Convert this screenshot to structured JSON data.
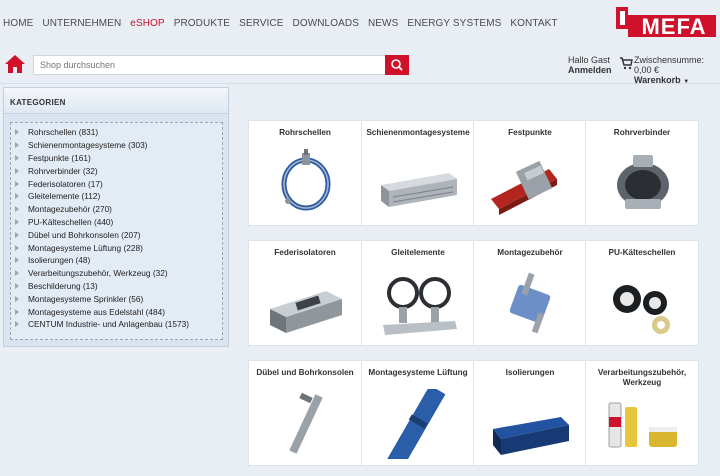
{
  "nav": {
    "items": [
      "HOME",
      "UNTERNEHMEN",
      "eSHOP",
      "PRODUKTE",
      "SERVICE",
      "DOWNLOADS",
      "NEWS",
      "ENERGY SYSTEMS",
      "KONTAKT"
    ],
    "active": "eSHOP"
  },
  "logo": {
    "text": "MEFA",
    "color": "#d0112b"
  },
  "search": {
    "placeholder": "Shop durchsuchen"
  },
  "account": {
    "greeting": "Hallo Gast",
    "login": "Anmelden"
  },
  "cart": {
    "subtotal": "Zwischensumme: 0,00 €",
    "label": "Warenkorb"
  },
  "sidebar": {
    "title": "KATEGORIEN",
    "items": [
      "Rohrschellen (831)",
      "Schienenmontagesysteme (303)",
      "Festpunkte (161)",
      "Rohrverbinder (32)",
      "Federisolatoren (17)",
      "Gleitelemente (112)",
      "Montagezubehör (270)",
      "PU-Kälteschellen (440)",
      "Dübel und Bohrkonsolen (207)",
      "Montagesysteme Lüftung (228)",
      "Isolierungen (48)",
      "Verarbeitungszubehör, Werkzeug (32)",
      "Beschilderung (13)",
      "Montagesysteme Sprinkler (56)",
      "Montagesysteme aus Edelstahl (484)",
      "CENTUM Industrie- und Anlagenbau (1573)"
    ]
  },
  "tiles": [
    {
      "title": "Rohrschellen",
      "icon": "pipe-clamp-icon"
    },
    {
      "title": "Schienenmontagesysteme",
      "icon": "rail-icon"
    },
    {
      "title": "Festpunkte",
      "icon": "fixed-point-icon"
    },
    {
      "title": "Rohrverbinder",
      "icon": "pipe-connector-icon"
    },
    {
      "title": "Federisolatoren",
      "icon": "spring-isolator-icon"
    },
    {
      "title": "Gleitelemente",
      "icon": "sliding-element-icon"
    },
    {
      "title": "Montagezubehör",
      "icon": "mounting-accessory-icon"
    },
    {
      "title": "PU-Kälteschellen",
      "icon": "pu-clamp-icon"
    },
    {
      "title": "Dübel und Bohrkonsolen",
      "icon": "anchor-bolt-icon"
    },
    {
      "title": "Montagesysteme Lüftung",
      "icon": "ventilation-pipe-icon"
    },
    {
      "title": "Isolierungen",
      "icon": "insulation-icon"
    },
    {
      "title": "Verarbeitungszubehör, Werkzeug",
      "icon": "tools-icon"
    }
  ]
}
